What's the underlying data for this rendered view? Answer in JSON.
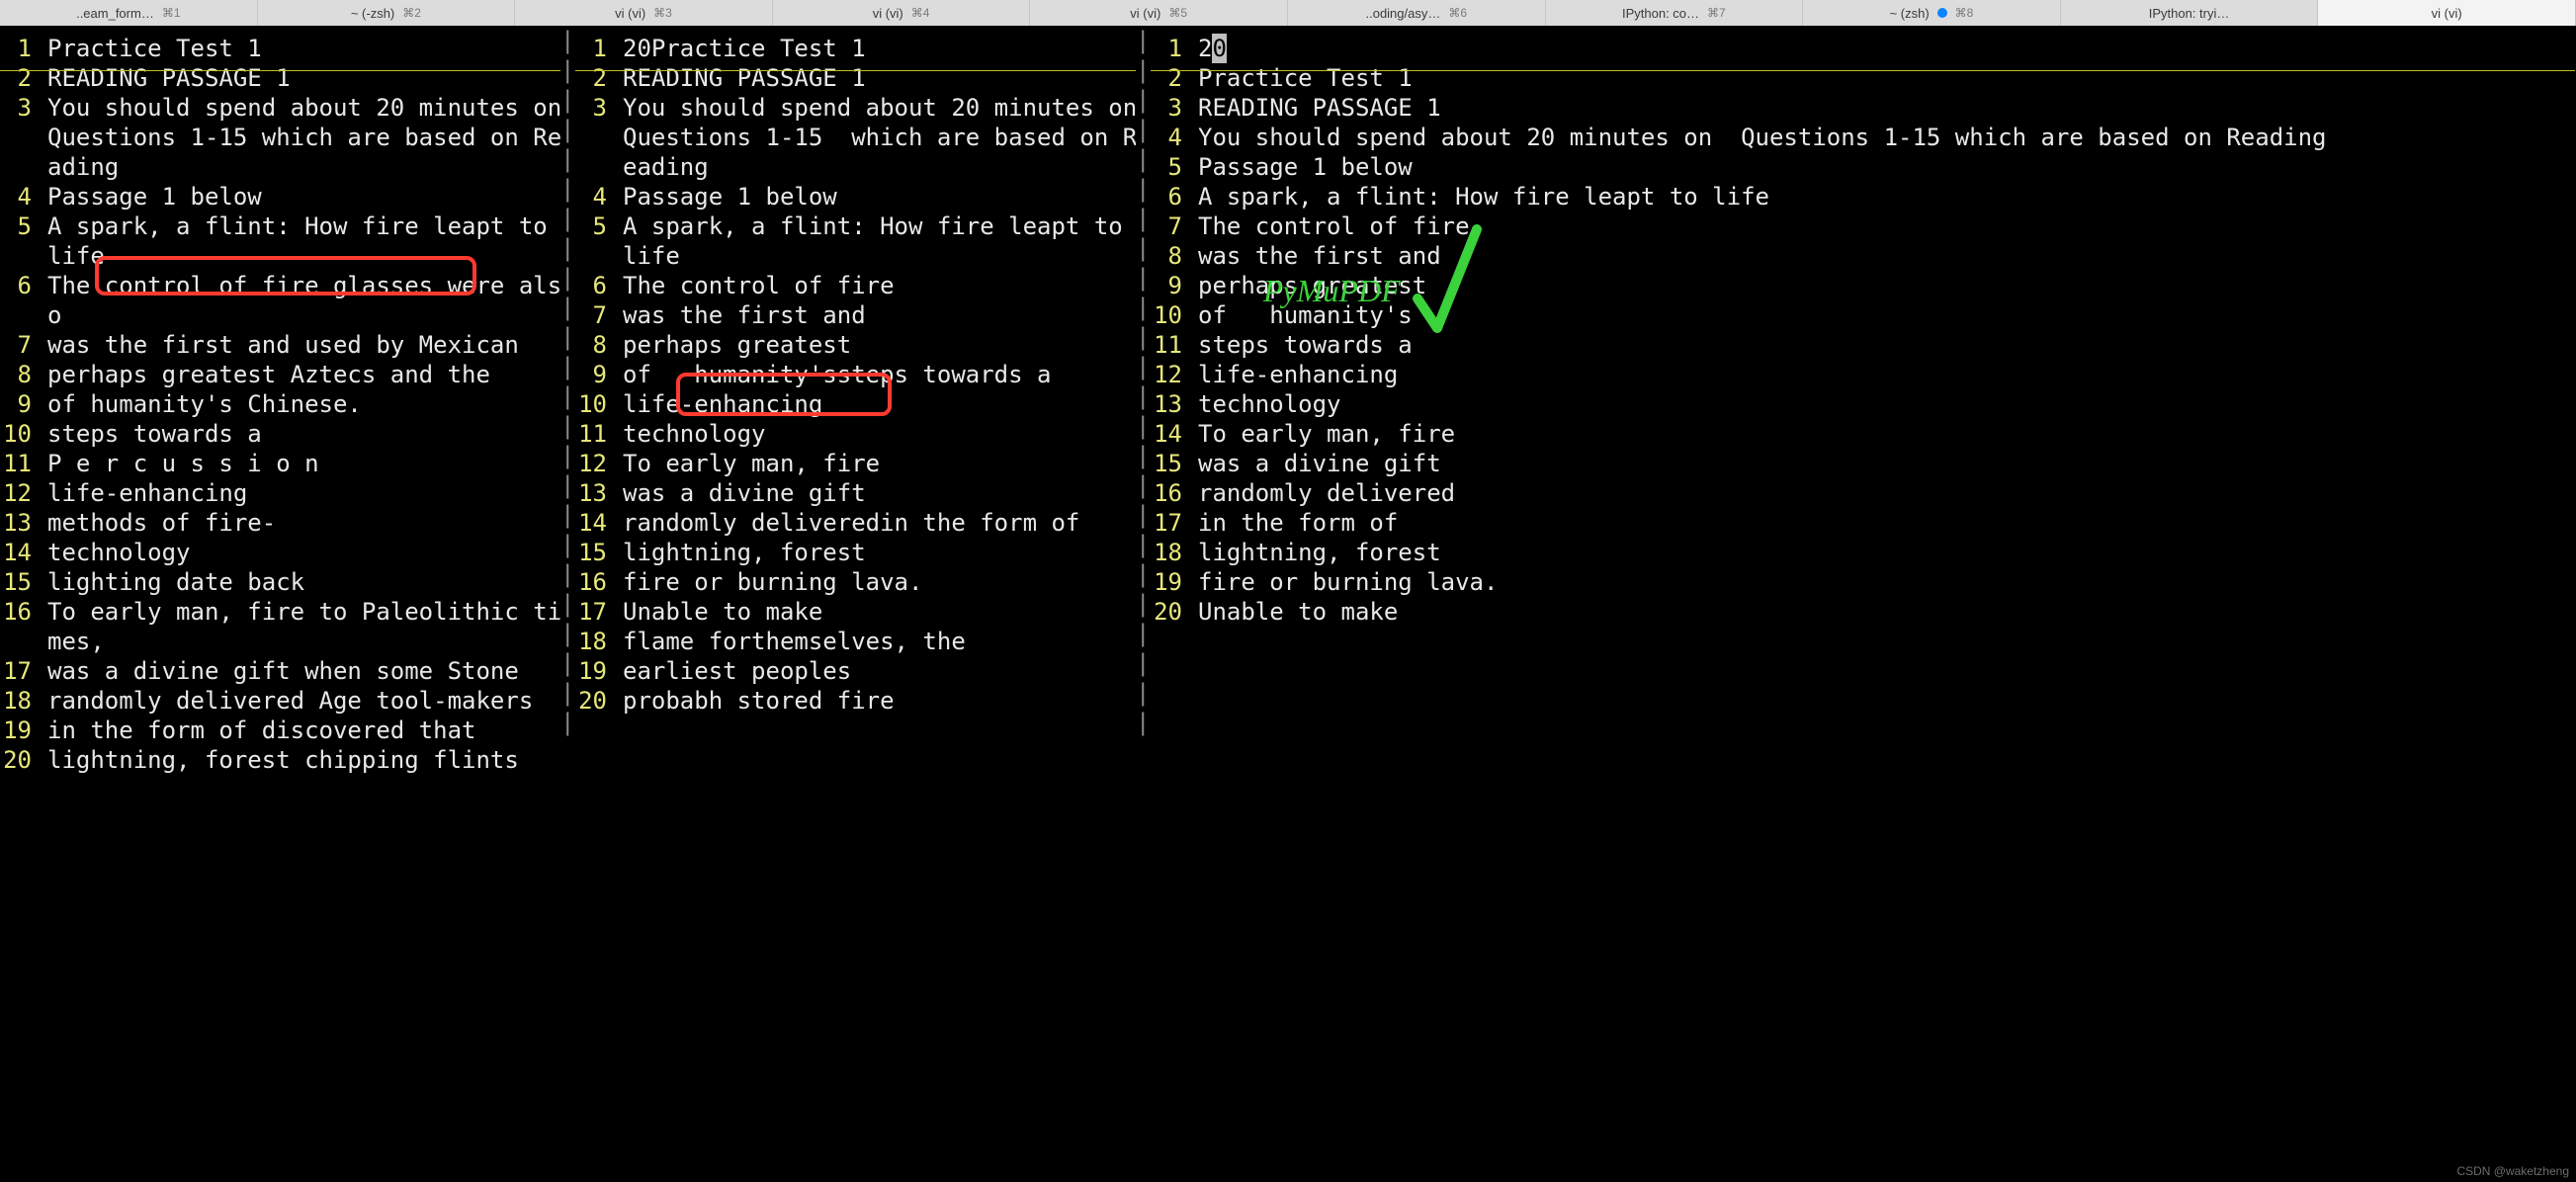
{
  "tabs": [
    {
      "label": "..eam_form…",
      "shortcut": "⌘1"
    },
    {
      "label": "~ (-zsh)",
      "shortcut": "⌘2"
    },
    {
      "label": "vi (vi)",
      "shortcut": "⌘3"
    },
    {
      "label": "vi (vi)",
      "shortcut": "⌘4"
    },
    {
      "label": "vi (vi)",
      "shortcut": "⌘5"
    },
    {
      "label": "..oding/asy…",
      "shortcut": "⌘6"
    },
    {
      "label": "IPython: co…",
      "shortcut": "⌘7"
    },
    {
      "label": "~ (zsh)",
      "shortcut": "⌘8",
      "dot": true
    },
    {
      "label": "IPython: tryi…",
      "shortcut": ""
    },
    {
      "label": "vi (vi)",
      "shortcut": "",
      "active": true
    }
  ],
  "pane1": {
    "lines": [
      {
        "n": "1",
        "t": "Practice Test 1"
      },
      {
        "n": "2",
        "t": "READING PASSAGE 1"
      },
      {
        "n": "3",
        "t": "You should spend about 20 minutes on Questions 1-15 which are based on Reading"
      },
      {
        "n": "4",
        "t": "Passage 1 below"
      },
      {
        "n": "5",
        "t": "A spark, a flint: How fire leapt to life"
      },
      {
        "n": "6",
        "t": "The control of fire glasses were also"
      },
      {
        "n": "7",
        "t": "was the first and used by Mexican"
      },
      {
        "n": "8",
        "t": "perhaps greatest Aztecs and the"
      },
      {
        "n": "9",
        "t": "of humanity's Chinese."
      },
      {
        "n": "10",
        "t": "steps towards a"
      },
      {
        "n": "11",
        "t": "P e r c u s s i o n"
      },
      {
        "n": "12",
        "t": "life-enhancing"
      },
      {
        "n": "13",
        "t": "methods of fire-"
      },
      {
        "n": "14",
        "t": "technology"
      },
      {
        "n": "15",
        "t": "lighting date back"
      },
      {
        "n": "16",
        "t": "To early man, fire to Paleolithic times,"
      },
      {
        "n": "17",
        "t": "was a divine gift when some Stone"
      },
      {
        "n": "18",
        "t": "randomly delivered Age tool-makers"
      },
      {
        "n": "19",
        "t": "in the form of discovered that"
      },
      {
        "n": "20",
        "t": "lightning, forest chipping flints"
      }
    ]
  },
  "pane2": {
    "lines": [
      {
        "n": "1",
        "t": "20Practice Test 1"
      },
      {
        "n": "2",
        "t": "READING PASSAGE 1"
      },
      {
        "n": "3",
        "t": "You should spend about 20 minutes on  Questions 1-15  which are based on Reading"
      },
      {
        "n": "4",
        "t": "Passage 1 below"
      },
      {
        "n": "5",
        "t": "A spark, a flint: How fire leapt to life"
      },
      {
        "n": "6",
        "t": "The control of fire"
      },
      {
        "n": "7",
        "t": "was the first and"
      },
      {
        "n": "8",
        "t": "perhaps greatest"
      },
      {
        "n": "9",
        "t": "of   humanity'ssteps towards a"
      },
      {
        "n": "10",
        "t": "life-enhancing"
      },
      {
        "n": "11",
        "t": "technology"
      },
      {
        "n": "12",
        "t": "To early man, fire"
      },
      {
        "n": "13",
        "t": "was a divine gift"
      },
      {
        "n": "14",
        "t": "randomly deliveredin the form of"
      },
      {
        "n": "15",
        "t": "lightning, forest"
      },
      {
        "n": "16",
        "t": "fire or burning lava."
      },
      {
        "n": "17",
        "t": "Unable to make"
      },
      {
        "n": "18",
        "t": "flame forthemselves, the"
      },
      {
        "n": "19",
        "t": "earliest peoples"
      },
      {
        "n": "20",
        "t": "probabh stored fire"
      }
    ]
  },
  "pane3": {
    "cursor_prefix": "2",
    "cursor_char": "0",
    "lines": [
      {
        "n": "1",
        "t": "20"
      },
      {
        "n": "2",
        "t": "Practice Test 1"
      },
      {
        "n": "3",
        "t": "READING PASSAGE 1"
      },
      {
        "n": "4",
        "t": "You should spend about 20 minutes on  Questions 1-15 which are based on Reading"
      },
      {
        "n": "5",
        "t": "Passage 1 below"
      },
      {
        "n": "6",
        "t": "A spark, a flint: How fire leapt to life"
      },
      {
        "n": "7",
        "t": "The control of fire"
      },
      {
        "n": "8",
        "t": "was the first and"
      },
      {
        "n": "9",
        "t": "perhaps greatest"
      },
      {
        "n": "10",
        "t": "of   humanity's"
      },
      {
        "n": "11",
        "t": "steps towards a"
      },
      {
        "n": "12",
        "t": "life-enhancing"
      },
      {
        "n": "13",
        "t": "technology"
      },
      {
        "n": "14",
        "t": "To early man, fire"
      },
      {
        "n": "15",
        "t": "was a divine gift"
      },
      {
        "n": "16",
        "t": "randomly delivered"
      },
      {
        "n": "17",
        "t": "in the form of"
      },
      {
        "n": "18",
        "t": "lightning, forest"
      },
      {
        "n": "19",
        "t": "fire or burning lava."
      },
      {
        "n": "20",
        "t": "Unable to make"
      }
    ]
  },
  "annotations": {
    "green_label": "PyMuPDF"
  },
  "watermark": "CSDN @waketzheng"
}
